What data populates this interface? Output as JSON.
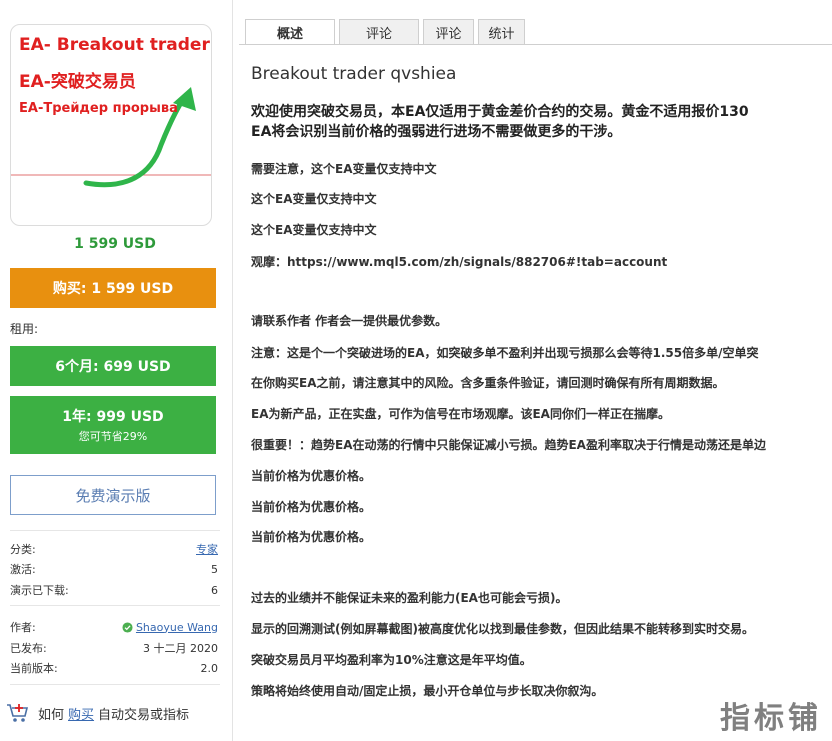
{
  "card": {
    "line1": "EA- Breakout trader",
    "line2": "EA-突破交易员",
    "line3": "EA-Трейдер прорыва"
  },
  "price": "1 599 USD",
  "buy_label": "购买: 1 599 USD",
  "rent_label": "租用:",
  "rent6_label": "6个月: 699 USD",
  "rent12_label": "1年: 999 USD",
  "rent12_sub": "您可节省29%",
  "demo_label": "免费演示版",
  "info": {
    "category_label": "分类:",
    "category_value": "专家",
    "activations_label": "激活:",
    "activations_value": "5",
    "downloads_label": "演示已下载:",
    "downloads_value": "6",
    "author_label": "作者:",
    "author_value": "Shaoyue Wang",
    "published_label": "已发布:",
    "published_value": "3 十二月 2020",
    "version_label": "当前版本:",
    "version_value": "2.0"
  },
  "howto": {
    "prefix": "如何",
    "link": "购买",
    "suffix": "自动交易或指标"
  },
  "tabs": [
    "概述",
    "评论",
    "评论",
    "统计"
  ],
  "main": {
    "title": "Breakout trader qvshiea",
    "intro_1": "欢迎使用突破交易员，本EA仅适用于黄金差价合约的交易。黄金不适用报价130",
    "intro_2": "EA将会识别当前价格的强弱进行进场不需要做更多的干涉。",
    "paragraphs": [
      "需要注意，这个EA变量仅支持中文",
      "这个EA变量仅支持中文",
      "这个EA变量仅支持中文",
      "观摩：https://www.mql5.com/zh/signals/882706#!tab=account",
      "请联系作者 作者会一提供最优参数。",
      "注意：这是个一个突破进场的EA，如突破多单不盈利并出现亏损那么会等待1.55倍多单/空单突",
      "在你购买EA之前，请注意其中的风险。含多重条件验证，请回测时确保有所有周期数据。",
      "EA为新产品，正在实盘，可作为信号在市场观摩。该EA同你们一样正在揣摩。",
      "很重要！：趋势EA在动荡的行情中只能保证减小亏损。趋势EA盈利率取决于行情是动荡还是单边",
      "当前价格为优惠价格。",
      "当前价格为优惠价格。",
      "当前价格为优惠价格。",
      "过去的业绩并不能保证未来的盈利能力(EA也可能会亏损)。",
      "显示的回溯测试(例如屏幕截图)被高度优化以找到最佳参数，但因此结果不能转移到实时交易。",
      "突破交易员月平均盈利率为10%注意这是年平均值。",
      "策略将始终使用自动/固定止损，最小开仓单位与步长取决你叙沟。"
    ]
  },
  "watermark": "指标铺",
  "colors": {
    "accent_orange": "#e8900f",
    "accent_green": "#3cb043",
    "price_green": "#2e9a3a",
    "link_blue": "#3768b0",
    "card_red": "#e02020"
  }
}
